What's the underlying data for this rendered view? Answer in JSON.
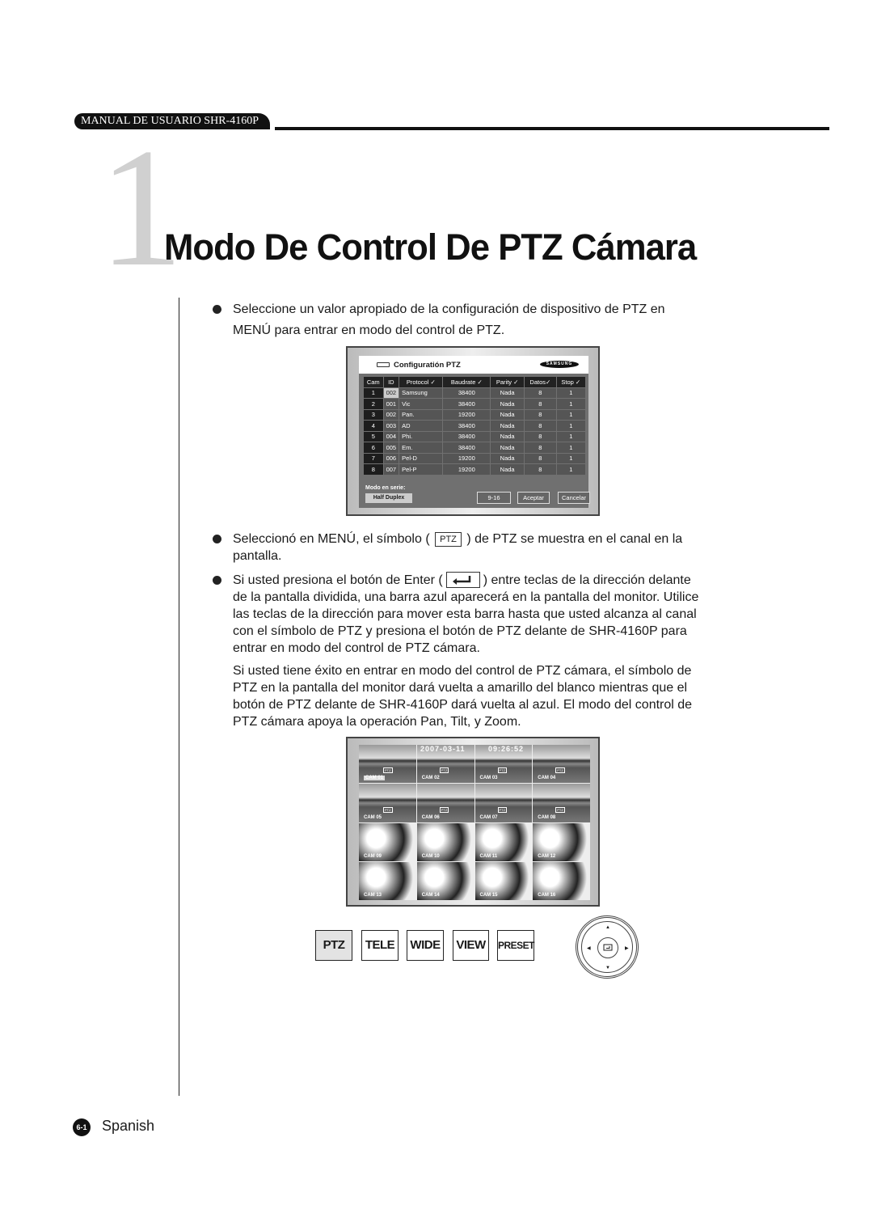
{
  "header": {
    "manual": "MANUAL DE USUARIO SHR-4160P"
  },
  "chapter": {
    "number": "1",
    "title": "Modo De Control De PTZ Cámara"
  },
  "p1": [
    "Seleccione un valor apropiado de la configuración de dispositivo de PTZ en",
    "MENÚ para entrar en modo del control de PTZ."
  ],
  "p2": {
    "a": "Seleccionó en MENÚ, el símbolo (",
    "sym": "PTZ",
    "b": ") de PTZ se muestra en el canal en la",
    "c": "pantalla."
  },
  "p3": {
    "a": "Si usted presiona el botón de Enter (",
    "b": ") entre teclas de la dirección delante",
    "lines": [
      "de la pantalla dividida, una barra azul aparecerá en la pantalla del monitor. Utilice",
      "las teclas de la dirección para mover esta barra hasta que usted alcanza al canal",
      "con el símbolo de PTZ y presiona el botón de PTZ delante de SHR-4160P para",
      "entrar en modo del control de PTZ cámara.",
      "Si usted tiene éxito en entrar en modo del control de PTZ cámara, el símbolo de",
      "PTZ en la pantalla del monitor dará vuelta a amarillo del blanco mientras que el",
      "botón de PTZ delante de SHR-4160P dará vuelta al azul. El modo del control de",
      "PTZ cámara apoya la operación Pan, Tilt, y Zoom."
    ]
  },
  "config": {
    "title": "Configuratión PTZ",
    "brand": "SAMSUNG",
    "columns": [
      "Cam",
      "ID",
      "Protocol ✓",
      "Baudrate ✓",
      "Parity ✓",
      "Datos✓",
      "Stop ✓"
    ],
    "rows": [
      [
        "1",
        "002",
        "Samsung",
        "38400",
        "Nada",
        "8",
        "1"
      ],
      [
        "2",
        "001",
        "Vic",
        "38400",
        "Nada",
        "8",
        "1"
      ],
      [
        "3",
        "002",
        "Pan.",
        "19200",
        "Nada",
        "8",
        "1"
      ],
      [
        "4",
        "003",
        "AD",
        "38400",
        "Nada",
        "8",
        "1"
      ],
      [
        "5",
        "004",
        "Phi.",
        "38400",
        "Nada",
        "8",
        "1"
      ],
      [
        "6",
        "005",
        "Em.",
        "38400",
        "Nada",
        "8",
        "1"
      ],
      [
        "7",
        "006",
        "Pel-D",
        "19200",
        "Nada",
        "8",
        "1"
      ],
      [
        "8",
        "007",
        "Pel-P",
        "19200",
        "Nada",
        "8",
        "1"
      ]
    ],
    "mode_label": "Modo en serie:",
    "mode_value": "Half Duplex",
    "page_button": "9-16",
    "accept": "Aceptar",
    "cancel": "Cancelar"
  },
  "monitor": {
    "date": "2007-03-11",
    "time": "09:26:52",
    "ptz_tag": "PTZ",
    "cams": [
      "CAM 01",
      "CAM 02",
      "CAM 03",
      "CAM 04",
      "CAM 05",
      "CAM 06",
      "CAM 07",
      "CAM 08",
      "CAM 09",
      "CAM 10",
      "CAM 11",
      "CAM 12",
      "CAM 13",
      "CAM 14",
      "CAM 15",
      "CAM 16"
    ]
  },
  "keys": [
    "PTZ",
    "TELE",
    "WIDE",
    "VIEW",
    "PRESET"
  ],
  "footer": {
    "page": "6-1",
    "language": "Spanish"
  }
}
